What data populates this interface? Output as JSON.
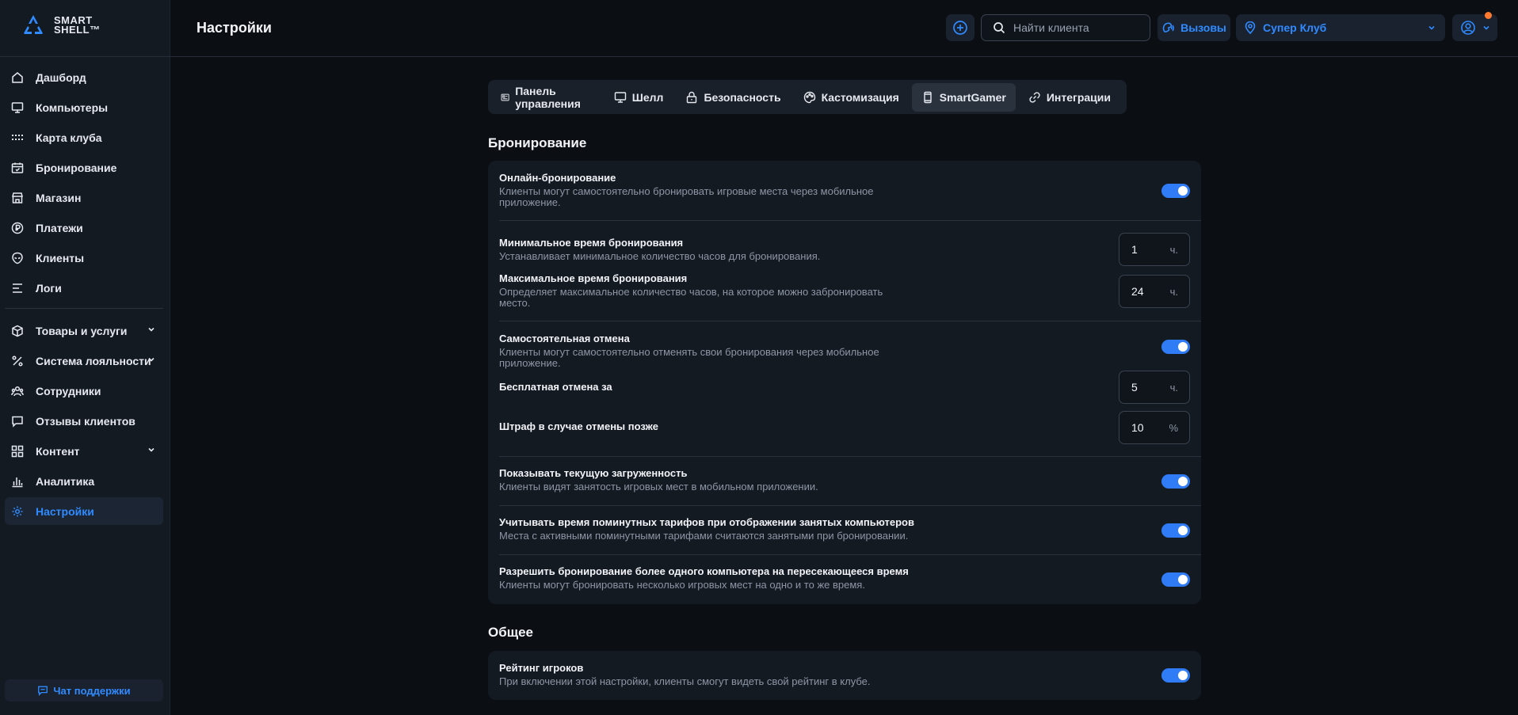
{
  "app": {
    "logo_line1": "SMART",
    "logo_line2": "SHELL™",
    "page_title": "Настройки"
  },
  "sidebar": {
    "items": [
      {
        "label": "Дашборд",
        "icon": "home-icon"
      },
      {
        "label": "Компьютеры",
        "icon": "monitor-icon"
      },
      {
        "label": "Карта клуба",
        "icon": "grid-dots-icon"
      },
      {
        "label": "Бронирование",
        "icon": "calendar-icon"
      },
      {
        "label": "Магазин",
        "icon": "store-icon"
      },
      {
        "label": "Платежи",
        "icon": "ruble-icon"
      },
      {
        "label": "Клиенты",
        "icon": "alien-icon"
      },
      {
        "label": "Логи",
        "icon": "lines-icon"
      }
    ],
    "items2": [
      {
        "label": "Товары и услуги",
        "icon": "box-icon",
        "expandable": true
      },
      {
        "label": "Система лояльности",
        "icon": "percent-icon",
        "expandable": true
      },
      {
        "label": "Сотрудники",
        "icon": "users-icon"
      },
      {
        "label": "Отзывы клиентов",
        "icon": "message-icon"
      },
      {
        "label": "Контент",
        "icon": "apps-icon",
        "expandable": true
      },
      {
        "label": "Аналитика",
        "icon": "bar-chart-icon"
      },
      {
        "label": "Настройки",
        "icon": "gear-icon",
        "active": true
      }
    ],
    "support_label": "Чат поддержки"
  },
  "header": {
    "search_placeholder": "Найти клиента",
    "calls_label": "Вызовы",
    "club_label": "Супер Клуб"
  },
  "tabs": [
    {
      "label": "Панель управления",
      "icon": "dashboard-icon"
    },
    {
      "label": "Шелл",
      "icon": "monitor-icon"
    },
    {
      "label": "Безопасность",
      "icon": "lock-icon"
    },
    {
      "label": "Кастомизация",
      "icon": "palette-icon"
    },
    {
      "label": "SmartGamer",
      "icon": "phone-icon",
      "active": true
    },
    {
      "label": "Интеграции",
      "icon": "link-icon"
    }
  ],
  "booking": {
    "title": "Бронирование",
    "online": {
      "title": "Онлайн-бронирование",
      "desc": "Клиенты могут самостоятельно бронировать игровые места через мобильное приложение.",
      "enabled": true
    },
    "min_time": {
      "title": "Минимальное время бронирования",
      "desc": "Устанавливает минимальное количество часов для бронирования.",
      "value": "1",
      "unit": "ч."
    },
    "max_time": {
      "title": "Максимальное время бронирования",
      "desc": "Определяет максимальное количество часов, на которое можно забронировать место.",
      "value": "24",
      "unit": "ч."
    },
    "self_cancel": {
      "title": "Самостоятельная отмена",
      "desc": "Клиенты могут самостоятельно отменять свои бронирования через мобильное приложение.",
      "enabled": true
    },
    "free_cancel": {
      "title": "Бесплатная отмена за",
      "value": "5",
      "unit": "ч."
    },
    "penalty": {
      "title": "Штраф в случае отмены позже",
      "value": "10",
      "unit": "%"
    },
    "load": {
      "title": "Показывать текущую загруженность",
      "desc": "Клиенты видят занятость игровых мест в мобильном приложении.",
      "enabled": true
    },
    "per_minute": {
      "title": "Учитывать время поминутных тарифов при отображении занятых компьютеров",
      "desc": "Места с активными поминутными тарифами считаются занятыми при бронировании.",
      "enabled": true
    },
    "multi": {
      "title": "Разрешить бронирование более одного компьютера на пересекающееся время",
      "desc": "Клиенты могут бронировать несколько игровых мест на одно и то же время.",
      "enabled": true
    }
  },
  "general": {
    "title": "Общее",
    "rating": {
      "title": "Рейтинг игроков",
      "desc": "При включении этой настройки, клиенты смогут видеть свой рейтинг в клубе.",
      "enabled": true
    }
  },
  "colors": {
    "accent": "#2f8bff",
    "toggle": "#2f7cf6",
    "badge": "#ff7a2e"
  }
}
